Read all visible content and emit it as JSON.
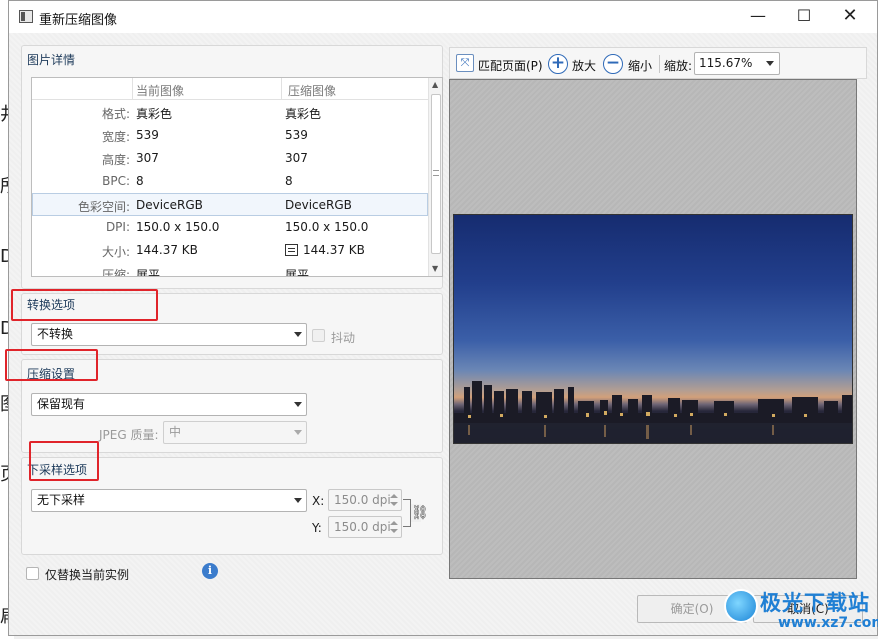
{
  "background": {
    "glyphs": [
      "井",
      "所",
      "D",
      "D",
      "图",
      "页",
      "扁"
    ]
  },
  "window": {
    "title": "重新压缩图像",
    "minimize": "—",
    "maximize": "☐",
    "close": "✕"
  },
  "details": {
    "title": "图片详情",
    "columns": [
      "当前图像",
      "压缩图像"
    ],
    "rows": [
      {
        "label": "格式:",
        "current": "真彩色",
        "compressed": "真彩色"
      },
      {
        "label": "宽度:",
        "current": "539",
        "compressed": "539"
      },
      {
        "label": "高度:",
        "current": "307",
        "compressed": "307"
      },
      {
        "label": "BPC:",
        "current": "8",
        "compressed": "8"
      },
      {
        "label": "色彩空间:",
        "current": "DeviceRGB",
        "compressed": "DeviceRGB"
      },
      {
        "label": "DPI:",
        "current": "150.0 x 150.0",
        "compressed": "150.0 x 150.0"
      },
      {
        "label": "大小:",
        "current": "144.37 KB",
        "compressed": "144.37 KB"
      },
      {
        "label": "压缩:",
        "current": "展平",
        "compressed": "展平"
      }
    ]
  },
  "convert": {
    "title": "转换选项",
    "select_value": "不转换",
    "dither_label": "抖动"
  },
  "compress": {
    "title": "压缩设置",
    "select_value": "保留现有",
    "jpeg_label": "JPEG 质量:",
    "jpeg_value": "中"
  },
  "downsample": {
    "title": "下采样选项",
    "select_value": "无下采样",
    "x_label": "X:",
    "x_value": "150.0 dpi",
    "y_label": "Y:",
    "y_value": "150.0 dpi"
  },
  "replace_only_current": "仅替换当前实例",
  "preview": {
    "fit_label": "匹配页面(P)",
    "zoom_in_label": "放大",
    "zoom_out_label": "缩小",
    "zoom_label": "缩放:",
    "zoom_value": "115.67%"
  },
  "buttons": {
    "ok": "确定(O)",
    "cancel": "取消(C)"
  },
  "watermark": {
    "title": "极光下载站",
    "url": "www.xz7.com"
  }
}
